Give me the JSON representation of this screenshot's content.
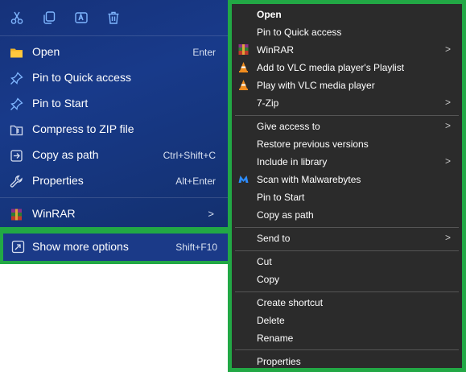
{
  "left_menu": {
    "toolbar_icons": [
      "cut-icon",
      "copy-icon",
      "rename-icon",
      "delete-icon"
    ],
    "items": [
      {
        "label": "Open",
        "shortcut": "Enter",
        "icon": "folder-icon"
      },
      {
        "label": "Pin to Quick access",
        "shortcut": "",
        "icon": "pin-icon"
      },
      {
        "label": "Pin to Start",
        "shortcut": "",
        "icon": "pin-icon"
      },
      {
        "label": "Compress to ZIP file",
        "shortcut": "",
        "icon": "zip-icon"
      },
      {
        "label": "Copy as path",
        "shortcut": "Ctrl+Shift+C",
        "icon": "copy-path-icon"
      },
      {
        "label": "Properties",
        "shortcut": "Alt+Enter",
        "icon": "wrench-icon"
      },
      {
        "label": "WinRAR",
        "shortcut": "",
        "icon": "winrar-icon",
        "submenu": true
      }
    ],
    "show_more": {
      "label": "Show more options",
      "shortcut": "Shift+F10",
      "icon": "show-more-icon"
    }
  },
  "right_menu": {
    "items": [
      {
        "label": "Open",
        "bold": true
      },
      {
        "label": "Pin to Quick access"
      },
      {
        "label": "WinRAR",
        "icon": "winrar-icon",
        "submenu": true
      },
      {
        "label": "Add to VLC media player's Playlist",
        "icon": "vlc-icon"
      },
      {
        "label": "Play with VLC media player",
        "icon": "vlc-icon"
      },
      {
        "label": "7-Zip",
        "submenu": true
      },
      {
        "label": "Give access to",
        "submenu": true
      },
      {
        "label": "Restore previous versions"
      },
      {
        "label": "Include in library",
        "submenu": true
      },
      {
        "label": "Scan with Malwarebytes",
        "icon": "malwarebytes-icon"
      },
      {
        "label": "Pin to Start"
      },
      {
        "label": "Copy as path"
      },
      {
        "label": "Send to",
        "submenu": true
      },
      {
        "label": "Cut"
      },
      {
        "label": "Copy"
      },
      {
        "label": "Create shortcut"
      },
      {
        "label": "Delete"
      },
      {
        "label": "Rename"
      },
      {
        "label": "Properties"
      }
    ],
    "arrow_glyph": ">"
  },
  "colors": {
    "highlight_border": "#22a845",
    "left_bg": "#183a8a",
    "right_bg": "#2b2b2b"
  }
}
